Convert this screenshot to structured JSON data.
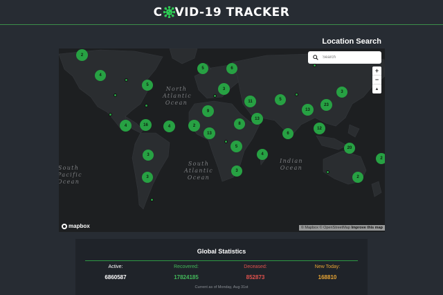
{
  "header": {
    "title_pre": "C",
    "title_post": "VID-19 TRACKER",
    "icon": "virus-icon"
  },
  "location_search": {
    "title": "Location Search",
    "placeholder": "Search",
    "icon": "search-icon"
  },
  "map": {
    "ocean_labels": [
      "North Atlantic Ocean",
      "South Atlantic Ocean",
      "South Pacific Ocean",
      "Indian Ocean"
    ],
    "zoom_in": "+",
    "zoom_out": "−",
    "compass": "▲",
    "logo": "mapbox",
    "attribution": "© Mapbox © OpenStreetMap",
    "attribution_link": "Improve this map",
    "cluster_color": "#27a143",
    "clusters": [
      "2",
      "4",
      "5",
      "5",
      "6",
      "3",
      "11",
      "5",
      "13",
      "23",
      "3",
      "9",
      "8",
      "13",
      "12",
      "4",
      "16",
      "2",
      "13",
      "6",
      "5",
      "20",
      "3",
      "4",
      "3",
      "3",
      "2",
      "2",
      "4"
    ]
  },
  "stats": {
    "title": "Global Statistics",
    "active": {
      "label": "Active:",
      "value": "6860587",
      "color": "#ffffff"
    },
    "recovered": {
      "label": "Recovered:",
      "value": "17824185",
      "color": "#43b85a"
    },
    "deceased": {
      "label": "Deceased:",
      "value": "852873",
      "color": "#e0524d"
    },
    "new_today": {
      "label": "New Today:",
      "value": "168810",
      "color": "#e8a534"
    },
    "footer": "Current as of Monday, Aug 31st"
  }
}
